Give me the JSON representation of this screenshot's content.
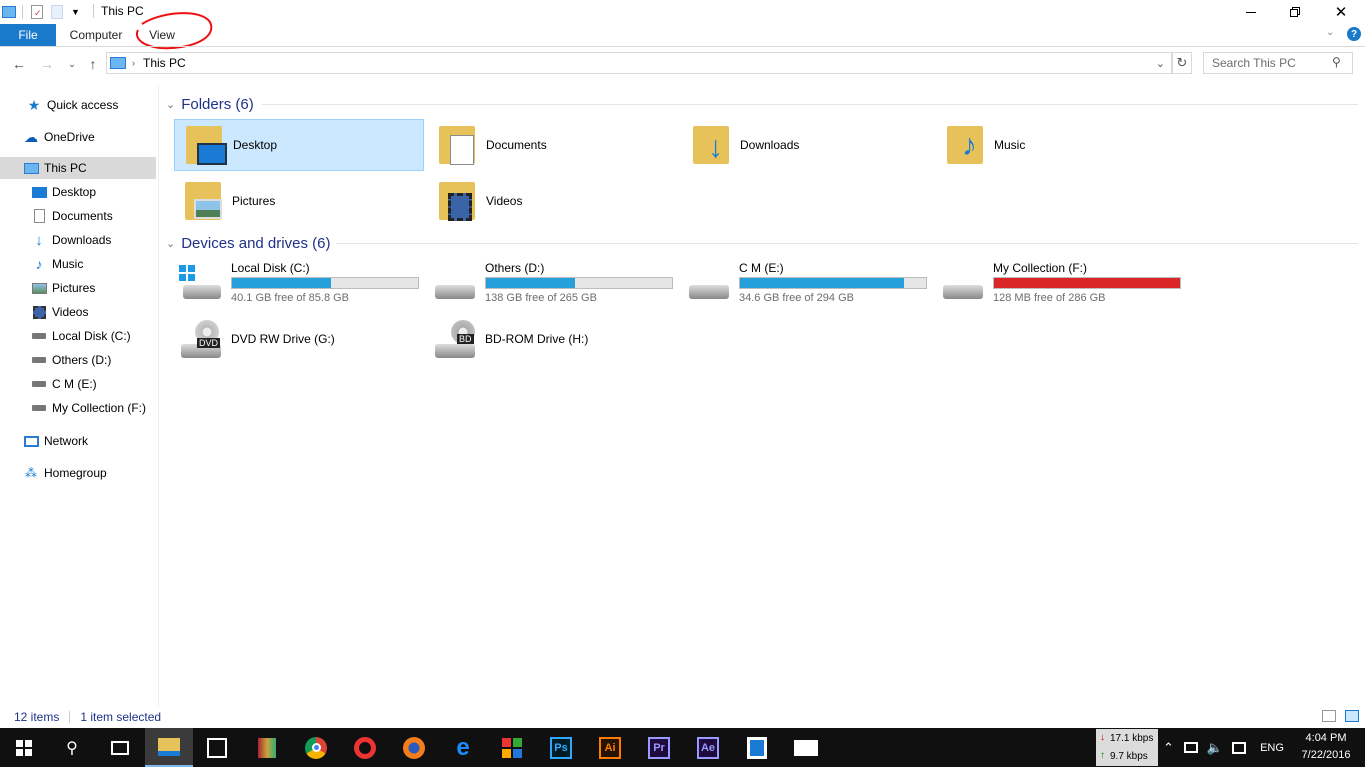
{
  "window": {
    "title": "This PC"
  },
  "ribbon": {
    "tabs": [
      "File",
      "Computer",
      "View"
    ]
  },
  "address": {
    "crumb": "This PC"
  },
  "search": {
    "placeholder": "Search This PC"
  },
  "nav": [
    {
      "label": "Quick access",
      "icon": "star-icon"
    },
    {
      "label": "OneDrive",
      "icon": "cloud-icon"
    },
    {
      "label": "This PC",
      "icon": "computer-icon"
    },
    {
      "label": "Desktop",
      "icon": "desktop-icon"
    },
    {
      "label": "Documents",
      "icon": "document-icon"
    },
    {
      "label": "Downloads",
      "icon": "download-icon"
    },
    {
      "label": "Music",
      "icon": "music-icon"
    },
    {
      "label": "Pictures",
      "icon": "picture-icon"
    },
    {
      "label": "Videos",
      "icon": "video-icon"
    },
    {
      "label": "Local Disk (C:)",
      "icon": "drive-icon"
    },
    {
      "label": "Others (D:)",
      "icon": "drive-icon"
    },
    {
      "label": "C M (E:)",
      "icon": "drive-icon"
    },
    {
      "label": "My Collection (F:)",
      "icon": "drive-icon"
    },
    {
      "label": "Network",
      "icon": "network-icon"
    },
    {
      "label": "Homegroup",
      "icon": "homegroup-icon"
    }
  ],
  "folders_group": {
    "title": "Folders (6)"
  },
  "folders": [
    {
      "label": "Desktop",
      "icon": "desktop-folder-icon"
    },
    {
      "label": "Documents",
      "icon": "documents-folder-icon"
    },
    {
      "label": "Downloads",
      "icon": "downloads-folder-icon"
    },
    {
      "label": "Music",
      "icon": "music-folder-icon"
    },
    {
      "label": "Pictures",
      "icon": "pictures-folder-icon"
    },
    {
      "label": "Videos",
      "icon": "videos-folder-icon"
    }
  ],
  "drives_group": {
    "title": "Devices and drives (6)"
  },
  "drives": [
    {
      "label": "Local Disk (C:)",
      "free": "40.1 GB free of 85.8 GB",
      "used_fraction": 0.53
    },
    {
      "label": "Others (D:)",
      "free": "138 GB free of 265 GB",
      "used_fraction": 0.48
    },
    {
      "label": "C M (E:)",
      "free": "34.6 GB free of 294 GB",
      "used_fraction": 0.88
    },
    {
      "label": "My Collection (F:)",
      "free": "128 MB free of 286 GB",
      "used_fraction": 1.0
    }
  ],
  "optical": [
    {
      "label": "DVD RW Drive (G:)",
      "badge": "DVD"
    },
    {
      "label": "BD-ROM Drive (H:)",
      "badge": "BD"
    }
  ],
  "status": {
    "items": "12 items",
    "selected": "1 item selected"
  },
  "taskbar": {
    "apps": [
      {
        "icon": "file-explorer-icon"
      },
      {
        "icon": "store-icon"
      },
      {
        "icon": "winrar-icon"
      },
      {
        "icon": "chrome-icon"
      },
      {
        "icon": "opera-icon"
      },
      {
        "icon": "firefox-icon"
      },
      {
        "icon": "edge-icon"
      },
      {
        "icon": "office-icon"
      },
      {
        "label": "Ps",
        "color": "#31a8ff"
      },
      {
        "label": "Ai",
        "color": "#ff7c00"
      },
      {
        "label": "Pr",
        "color": "#9999ff"
      },
      {
        "label": "Ae",
        "color": "#9999ff"
      },
      {
        "icon": "app-icon"
      },
      {
        "icon": "mail-icon"
      }
    ],
    "down_speed": "17.1 kbps",
    "up_speed": "9.7 kbps",
    "lang": "ENG",
    "time": "4:04 PM",
    "date": "7/22/2016"
  }
}
